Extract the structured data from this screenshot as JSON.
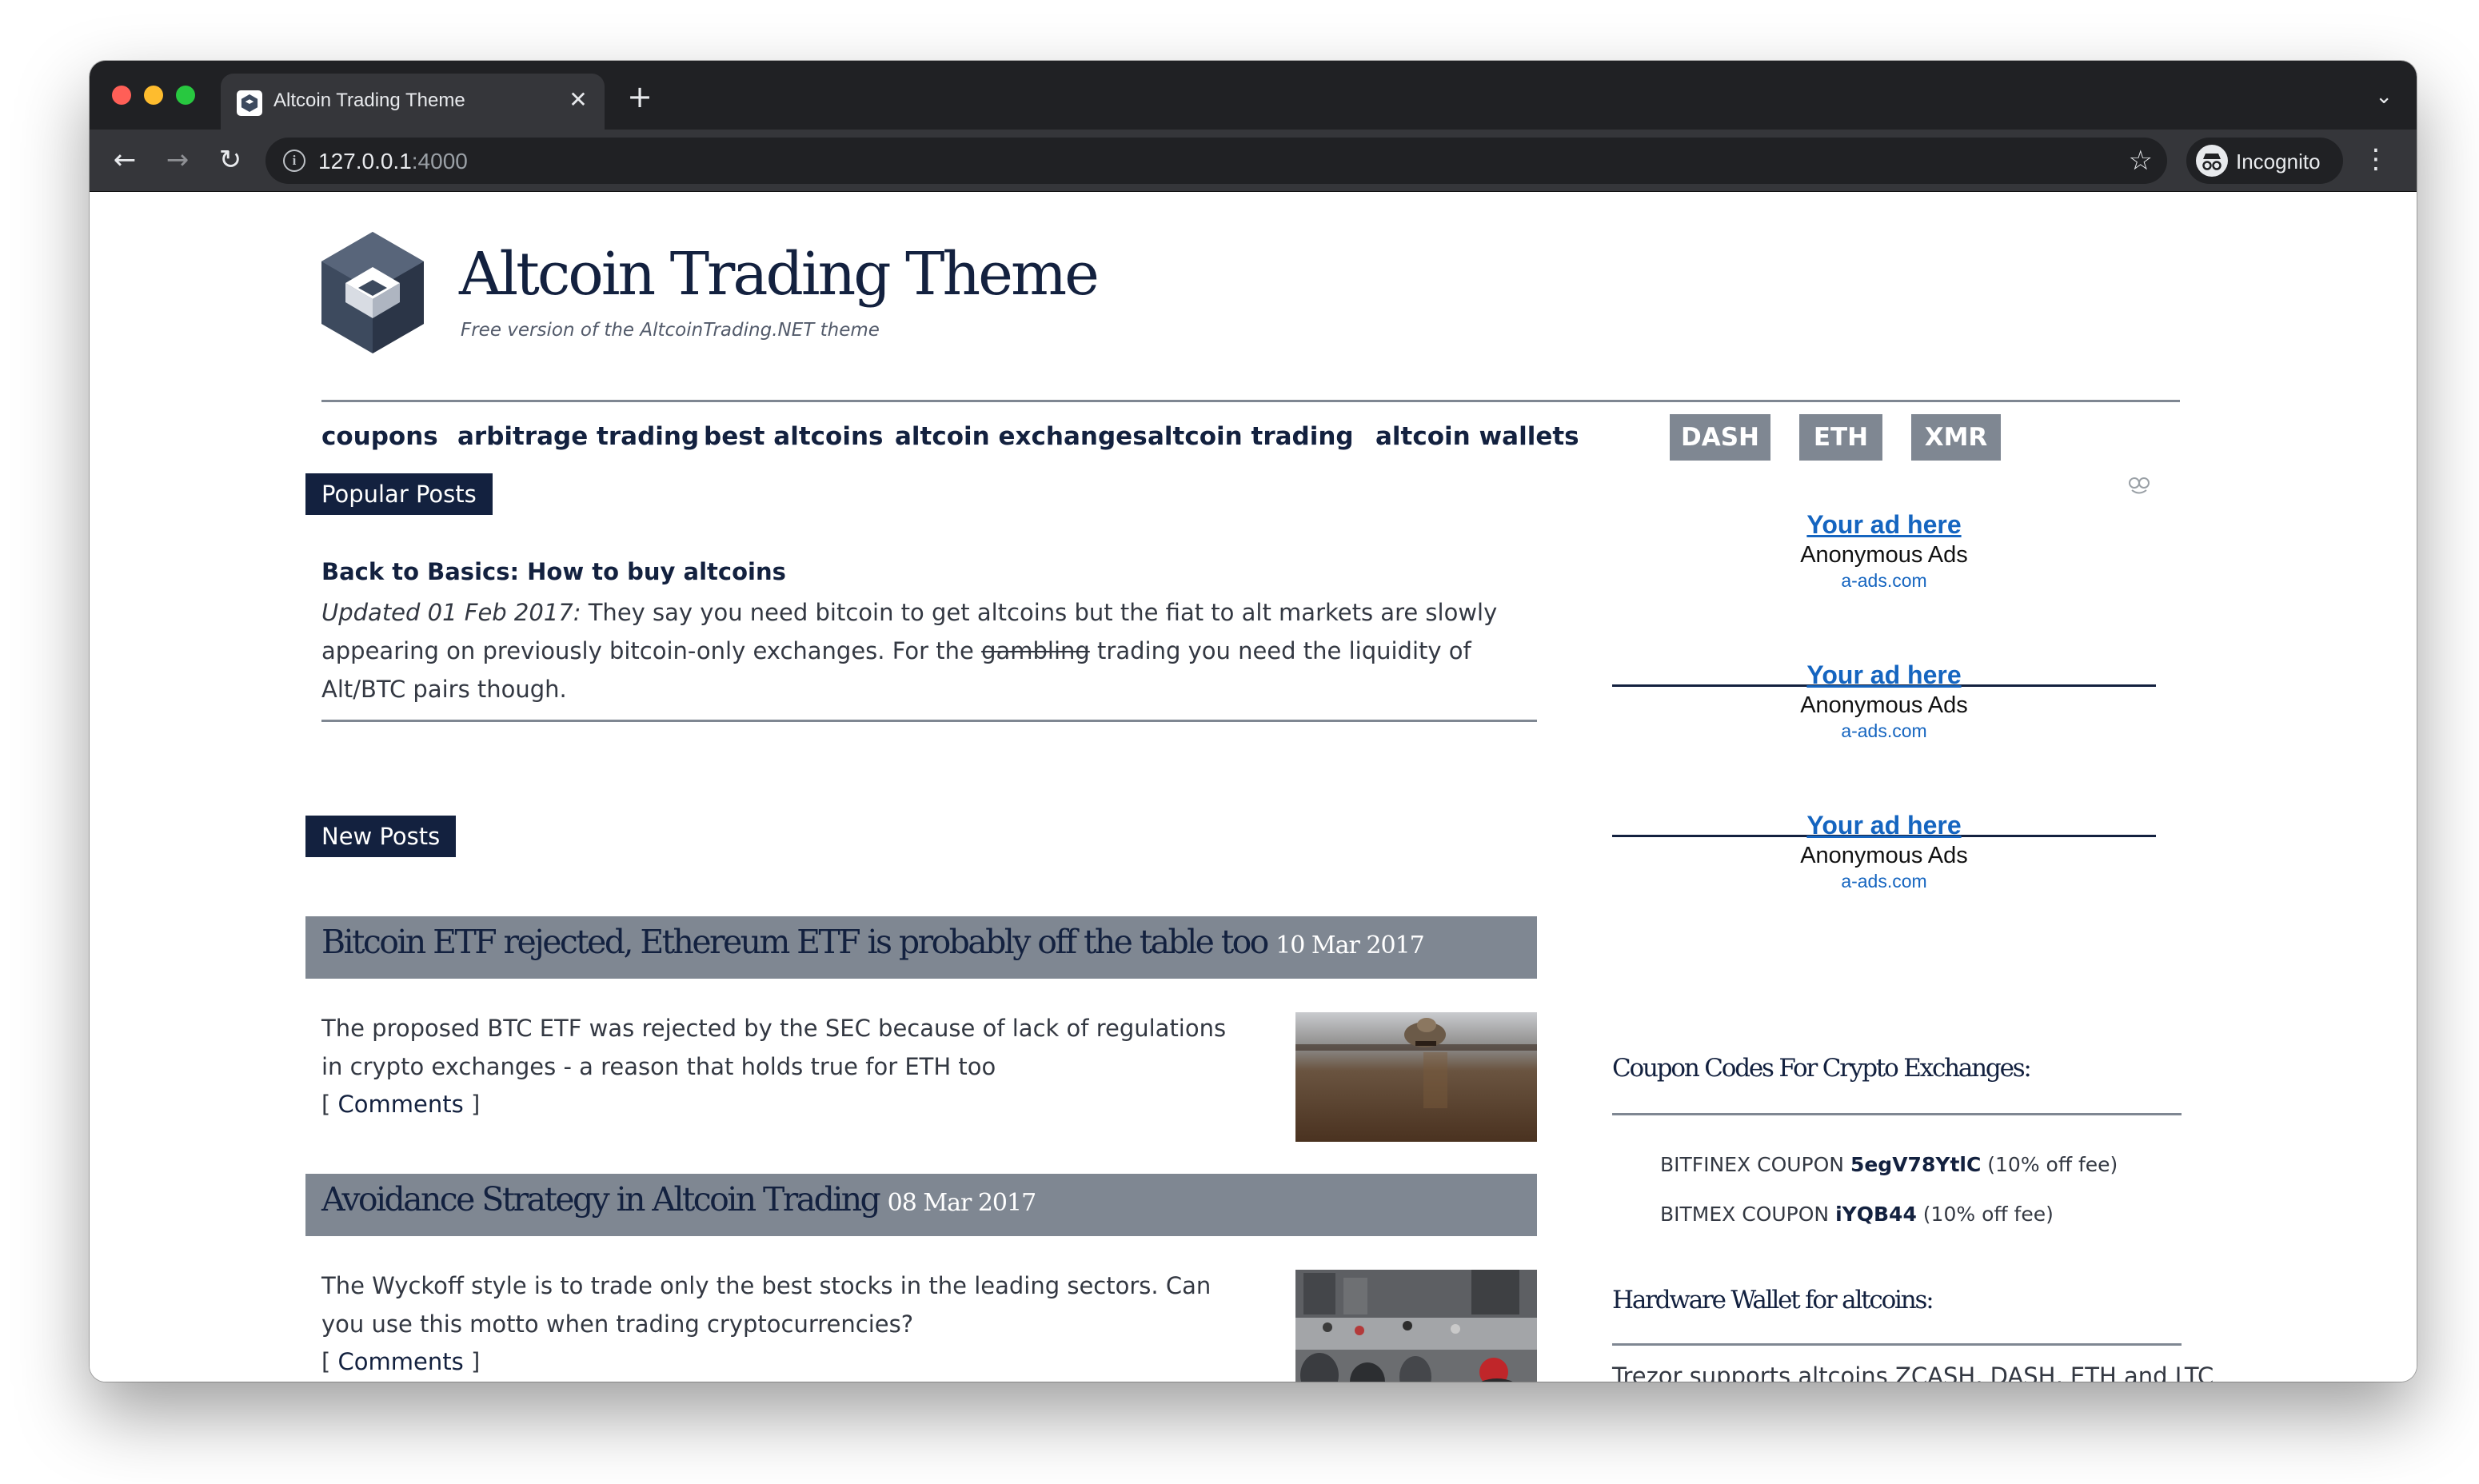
{
  "browser": {
    "tab_title": "Altcoin Trading Theme",
    "tab_close": "✕",
    "new_tab": "+",
    "url_host": "127.0.0.1",
    "url_port": ":4000",
    "profile_label": "Incognito"
  },
  "site": {
    "title": "Altcoin Trading Theme",
    "tagline": "Free version of the AltcoinTrading.NET theme"
  },
  "nav": {
    "links": [
      "coupons",
      "arbitrage trading",
      "best altcoins",
      "altcoin exchanges",
      "altcoin trading",
      "altcoin wallets"
    ],
    "pills": [
      "DASH",
      "ETH",
      "XMR"
    ]
  },
  "popular": {
    "label": "Popular Posts",
    "post_title": "Back to Basics: How to buy altcoins",
    "updated": "Updated 01 Feb 2017:",
    "text_before": " They say you need bitcoin to get altcoins but the fiat to alt markets are slowly appearing on previously bitcoin-only exchanges. For the ",
    "struck": "gambling",
    "text_after": " trading you need the liquidity of Alt/BTC pairs though."
  },
  "new_posts": {
    "label": "New Posts",
    "items": [
      {
        "title": "Bitcoin ETF rejected, Ethereum ETF is probably off the table too",
        "date": "10 Mar 2017",
        "excerpt": "The proposed BTC ETF was rejected by the SEC because of lack of regulations in crypto exchanges - a reason that holds true for ETH too",
        "comments_open": "[ ",
        "comments_link": "Comments",
        "comments_close": " ]"
      },
      {
        "title": "Avoidance Strategy in Altcoin Trading",
        "date": "08 Mar 2017",
        "excerpt": "The Wyckoff style is to trade only the best stocks in the leading sectors. Can you use this motto when trading cryptocurrencies?",
        "comments_open": "[ ",
        "comments_link": "Comments",
        "comments_close": " ]"
      }
    ]
  },
  "ads": [
    {
      "link": "Your ad here",
      "sub": "Anonymous Ads",
      "domain": "a-ads.com"
    },
    {
      "link": "Your ad here",
      "sub": "Anonymous Ads",
      "domain": "a-ads.com"
    },
    {
      "link": "Your ad here",
      "sub": "Anonymous Ads",
      "domain": "a-ads.com"
    }
  ],
  "coupons_widget": {
    "title": "Coupon Codes For Crypto Exchanges:",
    "items": [
      {
        "prefix": "BITFINEX COUPON ",
        "code": "5egV78YtlC",
        "suffix": " (10% off fee)"
      },
      {
        "prefix": "BITMEX COUPON ",
        "code": "iYQB44",
        "suffix": " (10% off fee)"
      }
    ]
  },
  "hardware_widget": {
    "title": "Hardware Wallet for altcoins:",
    "text": "Trezor supports altcoins ZCASH, DASH, ETH and LTC"
  },
  "colors": {
    "navy": "#13213f",
    "slate": "#7f8792",
    "ad_link": "#1565c0"
  }
}
